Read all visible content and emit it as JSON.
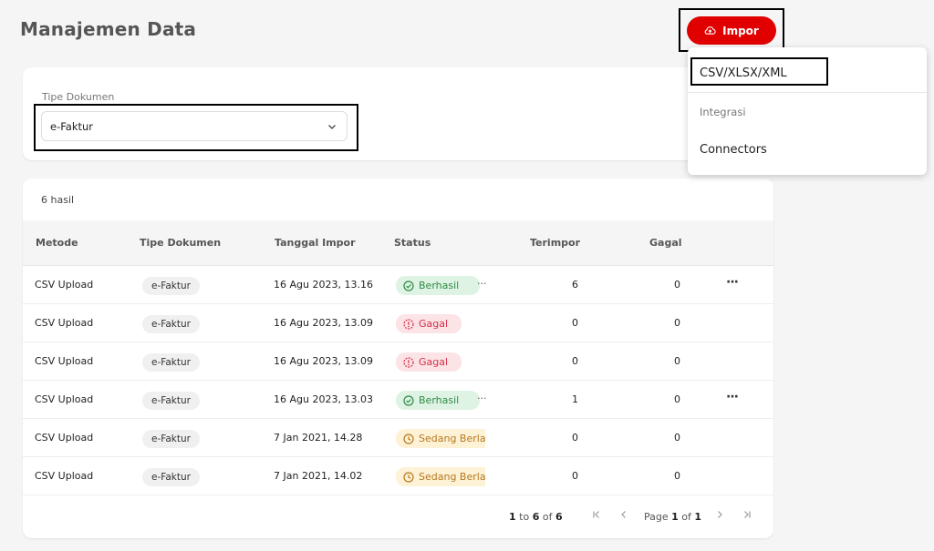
{
  "page_title": "Manajemen Data",
  "import_button": {
    "label": "Impor",
    "icon": "cloud-upload-icon"
  },
  "filter": {
    "label": "Tipe Dokumen",
    "selected": "e-Faktur"
  },
  "table": {
    "result_count": "6 hasil",
    "columns": [
      "Metode",
      "Tipe Dokumen",
      "Tanggal Impor",
      "Status",
      "Terimpor",
      "Gagal"
    ],
    "rows": [
      {
        "metode": "CSV Upload",
        "tipe": "e-Faktur",
        "tanggal": "16 Agu 2023, 13.16",
        "status": "Berhasil",
        "status_type": "success",
        "extra": "...",
        "terimpor": "6",
        "gagal": "0",
        "more": "···"
      },
      {
        "metode": "CSV Upload",
        "tipe": "e-Faktur",
        "tanggal": "16 Agu 2023, 13.09",
        "status": "Gagal",
        "status_type": "failed",
        "terimpor": "0",
        "gagal": "0"
      },
      {
        "metode": "CSV Upload",
        "tipe": "e-Faktur",
        "tanggal": "16 Agu 2023, 13.09",
        "status": "Gagal",
        "status_type": "failed",
        "terimpor": "0",
        "gagal": "0"
      },
      {
        "metode": "CSV Upload",
        "tipe": "e-Faktur",
        "tanggal": "16 Agu 2023, 13.03",
        "status": "Berhasil",
        "status_type": "success",
        "extra": "...",
        "terimpor": "1",
        "gagal": "0",
        "more": "···"
      },
      {
        "metode": "CSV Upload",
        "tipe": "e-Faktur",
        "tanggal": "7 Jan 2021, 14.28",
        "status": "Sedang Berlangsung",
        "status_type": "pending",
        "terimpor": "0",
        "gagal": "0"
      },
      {
        "metode": "CSV Upload",
        "tipe": "e-Faktur",
        "tanggal": "7 Jan 2021, 14.02",
        "status": "Sedang Berlangsung",
        "status_type": "pending",
        "terimpor": "0",
        "gagal": "0"
      }
    ]
  },
  "pagination": {
    "range_start": "1",
    "range_to": "to",
    "range_end": "6",
    "range_of": "of",
    "total": "6",
    "page_label": "Page",
    "current_page": "1",
    "page_of": "of",
    "total_pages": "1"
  },
  "dropdown": {
    "items": [
      "CSV/XLSX/XML"
    ],
    "group_label": "Integrasi",
    "group_items": [
      "Connectors"
    ]
  },
  "colors": {
    "accent": "#e00000",
    "success": "#2e8b45",
    "failed": "#d6304a",
    "pending": "#b7791f"
  }
}
